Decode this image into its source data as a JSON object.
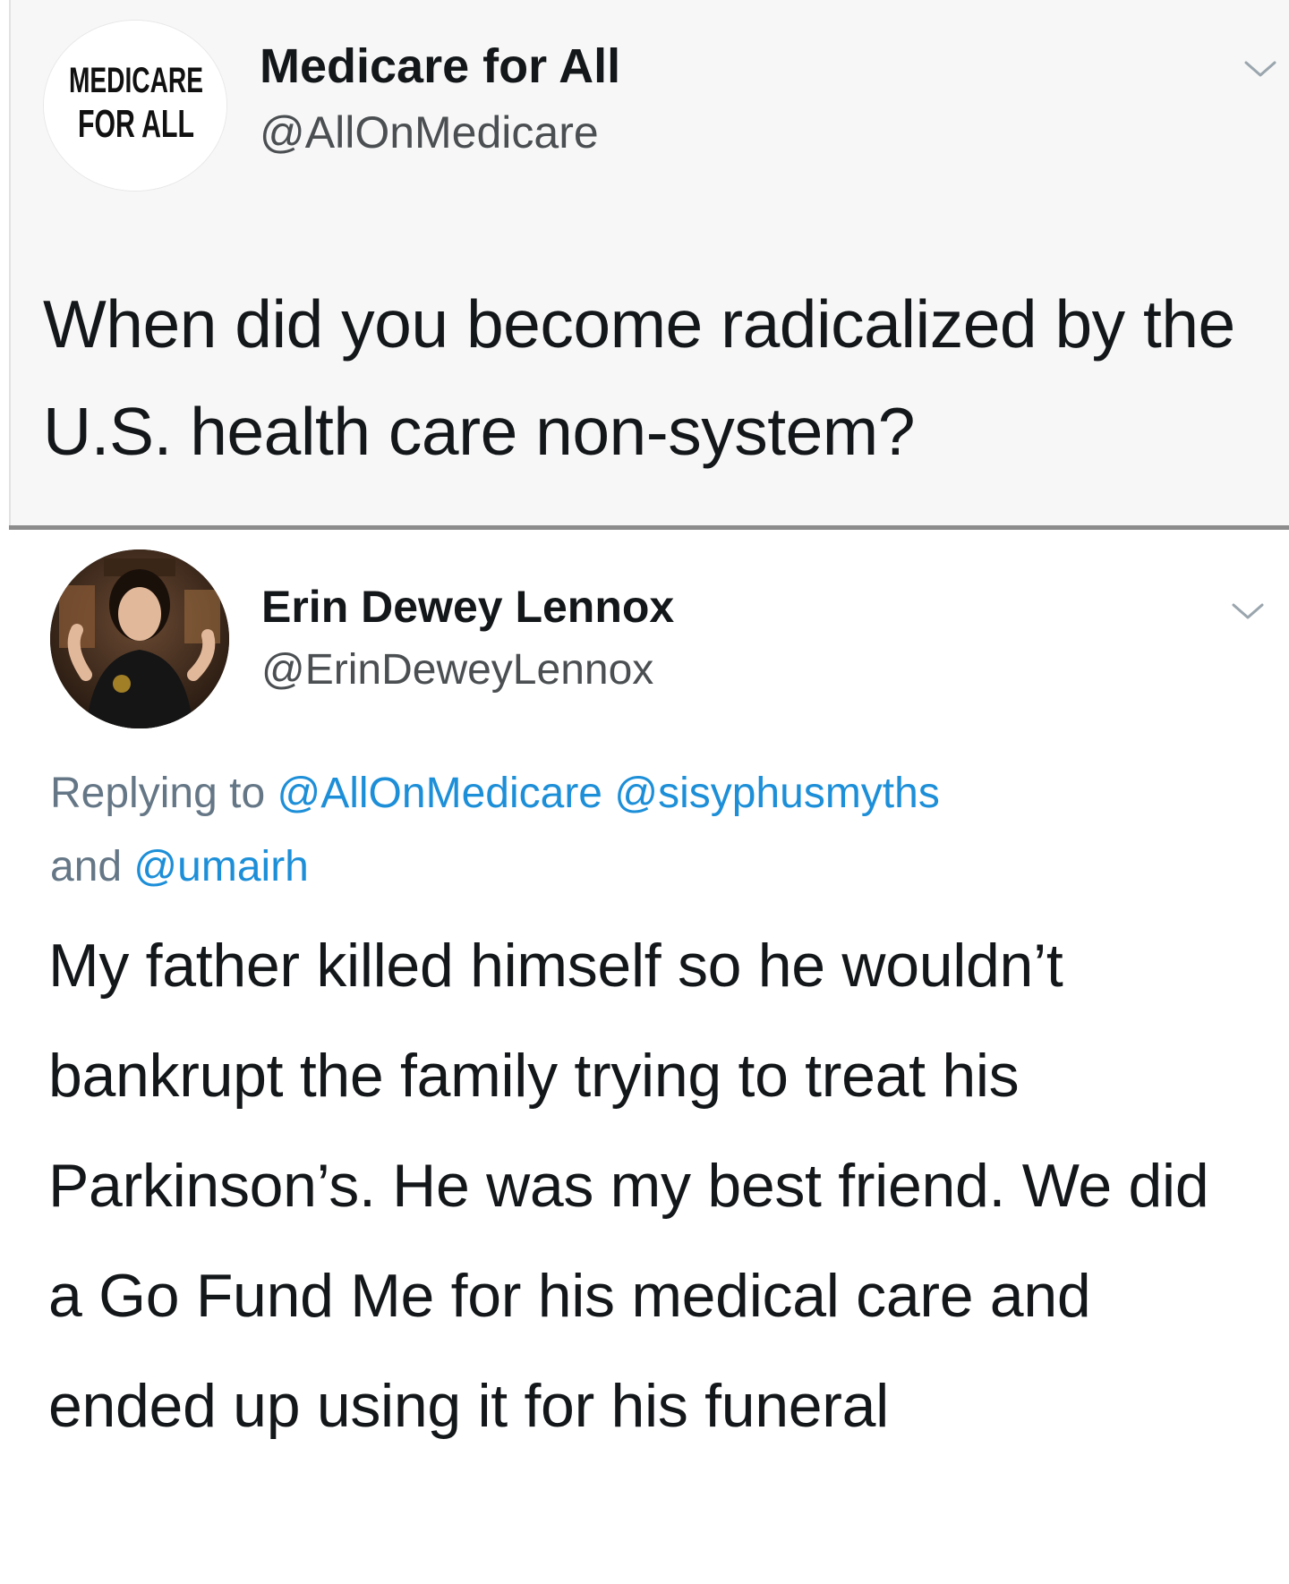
{
  "original_tweet": {
    "display_name": "Medicare for All",
    "handle": "@AllOnMedicare",
    "avatar_text": [
      "MEDICARE",
      "FOR ALL"
    ],
    "avatar_icon": "medicare-for-all-logo-icon",
    "menu_icon": "chevron-down-icon",
    "text": "When did you become radicalized by the U.S. health care non-system?"
  },
  "reply_tweet": {
    "display_name": "Erin Dewey Lennox",
    "handle": "@ErinDeweyLennox",
    "avatar_icon": "profile-photo-icon",
    "menu_icon": "chevron-down-icon",
    "replying_prefix": "Replying to ",
    "replying_mentions": [
      "@AllOnMedicare",
      "@sisyphusmyths"
    ],
    "replying_and": " and ",
    "replying_last": "@umairh",
    "text": "My father killed himself so he wouldn’t bankrupt the family trying to treat his Parkinson’s. He was my best friend. We did a Go Fund Me for his medical care and ended up using it for his funeral"
  },
  "colors": {
    "text": "#14171a",
    "handle": "#4b4f52",
    "muted": "#657786",
    "link": "#1d8fd8",
    "top_background": "#f7f7f7",
    "divider": "#8c8c8c"
  }
}
